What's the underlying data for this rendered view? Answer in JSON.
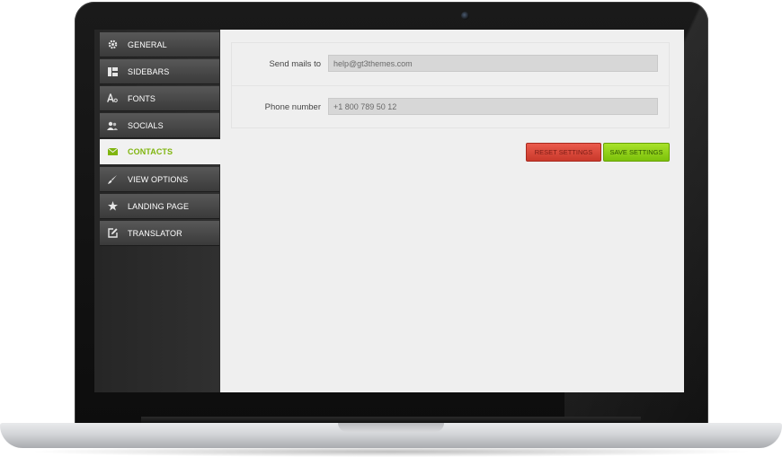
{
  "sidebar": {
    "items": [
      {
        "label": "GENERAL",
        "icon": "gear-icon"
      },
      {
        "label": "SIDEBARS",
        "icon": "sidebar-layout-icon"
      },
      {
        "label": "FONTS",
        "icon": "font-icon"
      },
      {
        "label": "SOCIALS",
        "icon": "users-icon"
      },
      {
        "label": "CONTACTS",
        "icon": "envelope-icon",
        "active": true
      },
      {
        "label": "VIEW OPTIONS",
        "icon": "brush-icon"
      },
      {
        "label": "LANDING PAGE",
        "icon": "star-icon"
      },
      {
        "label": "TRANSLATOR",
        "icon": "edit-icon"
      }
    ]
  },
  "form": {
    "send_mails": {
      "label": "Send mails to",
      "value": "help@gt3themes.com"
    },
    "phone": {
      "label": "Phone number",
      "value": "+1 800 789 50 12"
    }
  },
  "actions": {
    "reset_label": "RESET SETTINGS",
    "save_label": "SAVE SETTINGS"
  },
  "colors": {
    "accent_green": "#80b50f",
    "reset_red": "#d8473a",
    "save_green": "#95d41c"
  }
}
